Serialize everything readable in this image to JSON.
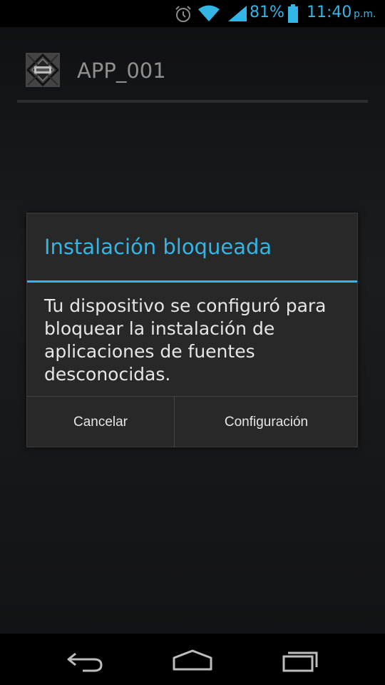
{
  "status_bar": {
    "battery_percent": "81%",
    "time": "11:40",
    "ampm": "p.m.",
    "accent_color": "#33b5e5",
    "icons": [
      "alarm-icon",
      "wifi-icon",
      "signal-icon",
      "battery-icon"
    ]
  },
  "action_bar": {
    "app_title": "APP_001",
    "icon": "app-logo-icon"
  },
  "dialog": {
    "title": "Instalación bloqueada",
    "message": "Tu dispositivo se configuró para bloquear la instalación de aplicaciones de fuentes desconocidas.",
    "buttons": {
      "cancel": "Cancelar",
      "settings": "Configuración"
    }
  },
  "nav_bar": {
    "buttons": [
      "back-icon",
      "home-icon",
      "recents-icon"
    ]
  }
}
